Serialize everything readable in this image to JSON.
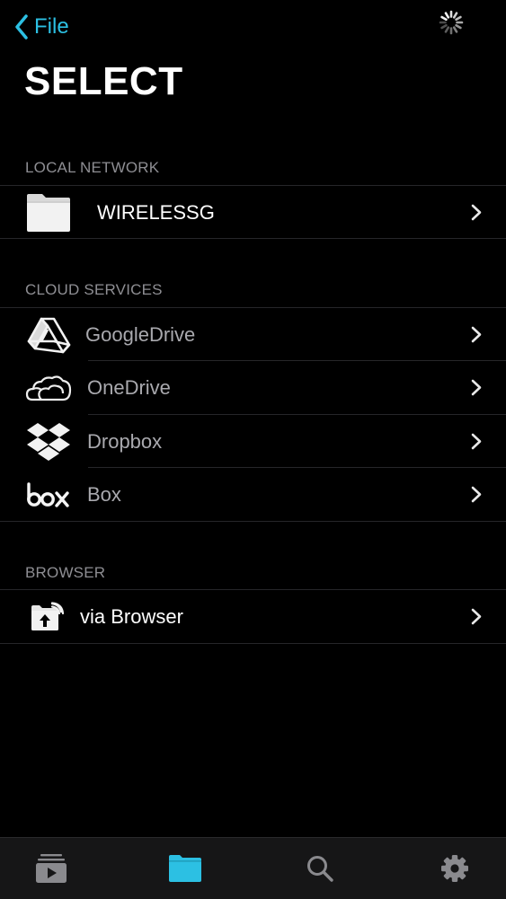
{
  "nav": {
    "back_label": "File"
  },
  "page": {
    "title": "SELECT"
  },
  "sections": {
    "local": {
      "header": "LOCAL NETWORK",
      "items": [
        {
          "label": "WIRELESSG",
          "icon": "folder-icon"
        }
      ]
    },
    "cloud": {
      "header": "CLOUD SERVICES",
      "items": [
        {
          "label": "GoogleDrive",
          "icon": "google-drive-icon"
        },
        {
          "label": "OneDrive",
          "icon": "onedrive-icon"
        },
        {
          "label": "Dropbox",
          "icon": "dropbox-icon"
        },
        {
          "label": "Box",
          "icon": "box-icon"
        }
      ]
    },
    "browser": {
      "header": "BROWSER",
      "items": [
        {
          "label": "via Browser",
          "icon": "wifi-folder-upload-icon"
        }
      ]
    }
  },
  "tabbar": {
    "tabs": [
      {
        "icon": "playlist-video-icon",
        "active": false
      },
      {
        "icon": "folder-icon",
        "active": true
      },
      {
        "icon": "search-icon",
        "active": false
      },
      {
        "icon": "gear-icon",
        "active": false
      }
    ]
  },
  "colors": {
    "accent": "#2cc0e3",
    "background": "#000000",
    "separator": "#262629",
    "section_header": "#8e8e93",
    "tab_inactive": "#8a8a8e"
  }
}
